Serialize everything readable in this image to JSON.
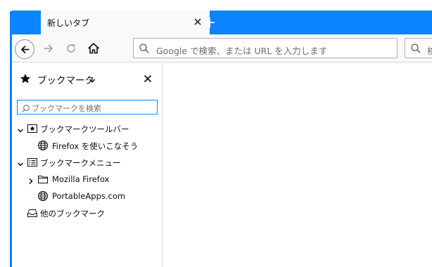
{
  "tab": {
    "title": "新しいタブ"
  },
  "toolbar": {
    "url_placeholder": "Google で検索、または URL を入力します",
    "search_placeholder": "検"
  },
  "sidebar": {
    "title": "ブックマーク",
    "search_placeholder": "ブックマークを検索",
    "items": [
      {
        "label": "ブックマークツールバー",
        "icon": "bookmark-toolbar-icon",
        "expanded": true
      },
      {
        "label": "Firefox を使いこなそう",
        "icon": "globe-icon"
      },
      {
        "label": "ブックマークメニュー",
        "icon": "bookmark-menu-icon",
        "expanded": true
      },
      {
        "label": "Mozilla Firefox",
        "icon": "folder-icon",
        "expanded": false
      },
      {
        "label": "PortableApps.com",
        "icon": "globe-icon"
      },
      {
        "label": "他のブックマーク",
        "icon": "other-bookmarks-icon"
      }
    ]
  },
  "colors": {
    "accent": "#0a84ff",
    "toolbar_bg": "#f9f9fa",
    "border": "#d7d7db",
    "text": "#0c0c0d"
  }
}
